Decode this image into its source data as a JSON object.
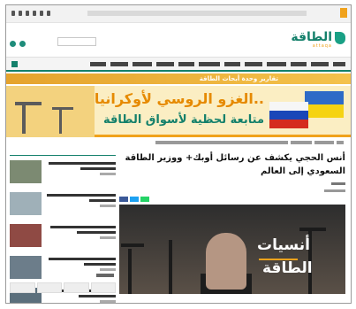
{
  "topbar": {
    "ticker_label": "",
    "social_icons": [
      "google-plus-icon",
      "youtube-icon",
      "email-icon",
      "linkedin-icon",
      "twitter-icon",
      "facebook-icon"
    ]
  },
  "logo": {
    "name": "الطاقة",
    "subtitle": "attaqa"
  },
  "promo_banner": {
    "text": "تقارير وحدة أبحاث الطاقة"
  },
  "hero_banner": {
    "line1": "الغزو الروسي لأوكرانيا..",
    "line2": "متابعة لحظية لأسواق الطاقة"
  },
  "article": {
    "headline": "أنس الحجي يكشف عن رسائل أوبك+ ووزير الطاقة السعودي إلى العالم",
    "feature_title_line1": "أنسيات",
    "feature_title_line2": "الطاقة"
  },
  "colors": {
    "brand_green": "#14806b",
    "brand_orange": "#f0a21c"
  }
}
